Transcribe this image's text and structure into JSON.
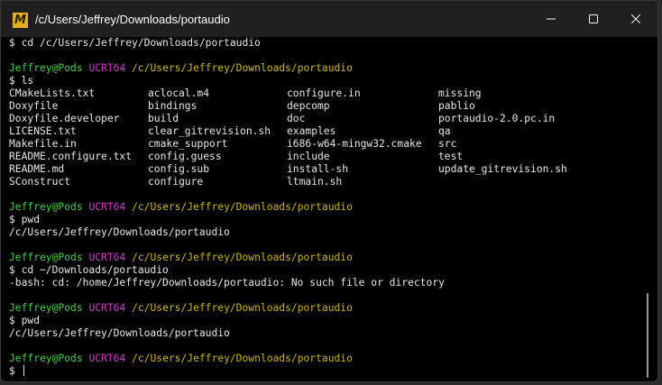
{
  "window": {
    "title": "/c/Users/Jeffrey/Downloads/portaudio",
    "app_icon_letter": "M",
    "icons": {
      "app": "msys2-icon",
      "minimize": "minimize-icon",
      "maximize": "maximize-icon",
      "close": "close-icon"
    }
  },
  "colors": {
    "background": "#000000",
    "text": "#e6e6e6",
    "user_host": "#4ec94e",
    "system_name": "#c046c0",
    "path": "#c9b32c",
    "titlebar": "#1f1f1f"
  },
  "terminal": {
    "initial_command": "$ cd /c/Users/Jeffrey/Downloads/portaudio",
    "prompt": {
      "user": "Jeffrey@Pods",
      "system": "UCRT64",
      "path": "/c/Users/Jeffrey/Downloads/portaudio"
    },
    "cmd_ls": "$ ls",
    "ls_columns": [
      [
        "CMakeLists.txt",
        "Doxyfile",
        "Doxyfile.developer",
        "LICENSE.txt",
        "Makefile.in",
        "README.configure.txt",
        "README.md",
        "SConstruct"
      ],
      [
        "aclocal.m4",
        "bindings",
        "build",
        "clear_gitrevision.sh",
        "cmake_support",
        "config.guess",
        "config.sub",
        "configure"
      ],
      [
        "configure.in",
        "depcomp",
        "doc",
        "examples",
        "i686-w64-mingw32.cmake",
        "include",
        "install-sh",
        "ltmain.sh"
      ],
      [
        "missing",
        "pablio",
        "portaudio-2.0.pc.in",
        "qa",
        "src",
        "test",
        "update_gitrevision.sh"
      ]
    ],
    "cmd_pwd_1": "$ pwd",
    "out_pwd_1": "/c/Users/Jeffrey/Downloads/portaudio",
    "cmd_cd_home": "$ cd ~/Downloads/portaudio",
    "out_cd_error": "-bash: cd: /home/Jeffrey/Downloads/portaudio: No such file or directory",
    "cmd_pwd_2": "$ pwd",
    "out_pwd_2": "/c/Users/Jeffrey/Downloads/portaudio",
    "final_prompt_symbol": "$ "
  }
}
